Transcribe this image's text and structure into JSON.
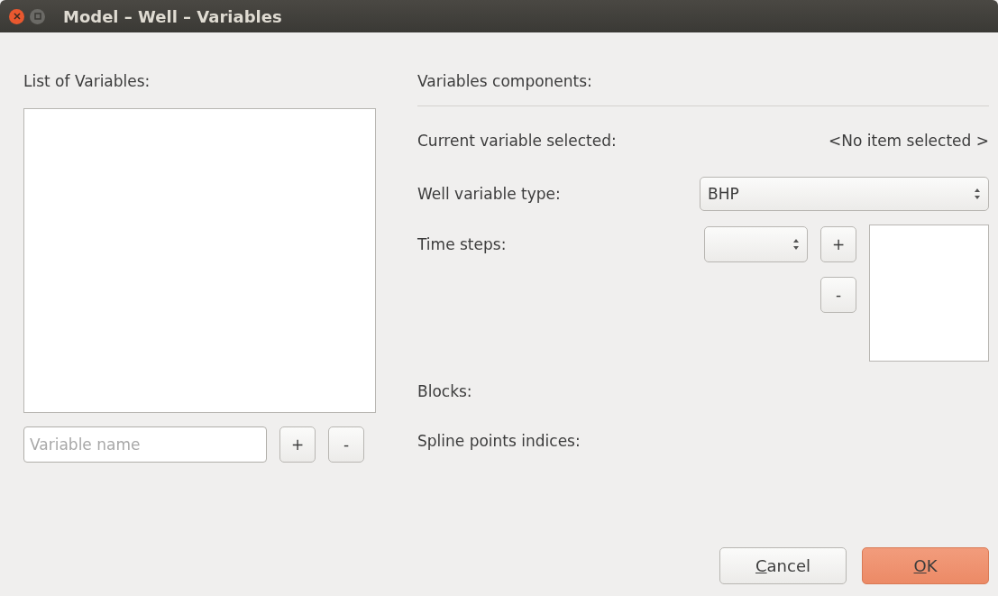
{
  "window": {
    "title": "Model – Well – Variables"
  },
  "left": {
    "heading": "List of Variables:",
    "name_field": {
      "placeholder": "Variable name"
    },
    "add_button": "+",
    "remove_button": "-"
  },
  "right": {
    "heading": "Variables components:",
    "current": {
      "label": "Current variable selected:",
      "value": "<No item selected >"
    },
    "type": {
      "label": "Well variable type:",
      "value": "BHP"
    },
    "time_steps": {
      "label": "Time steps:",
      "add_button": "+",
      "remove_button": "-"
    },
    "blocks": {
      "label": "Blocks:"
    },
    "spline": {
      "label": "Spline points indices:"
    }
  },
  "buttons": [
    {
      "label": "Cancel",
      "kind": "secondary"
    },
    {
      "label": "OK",
      "kind": "primary"
    }
  ]
}
